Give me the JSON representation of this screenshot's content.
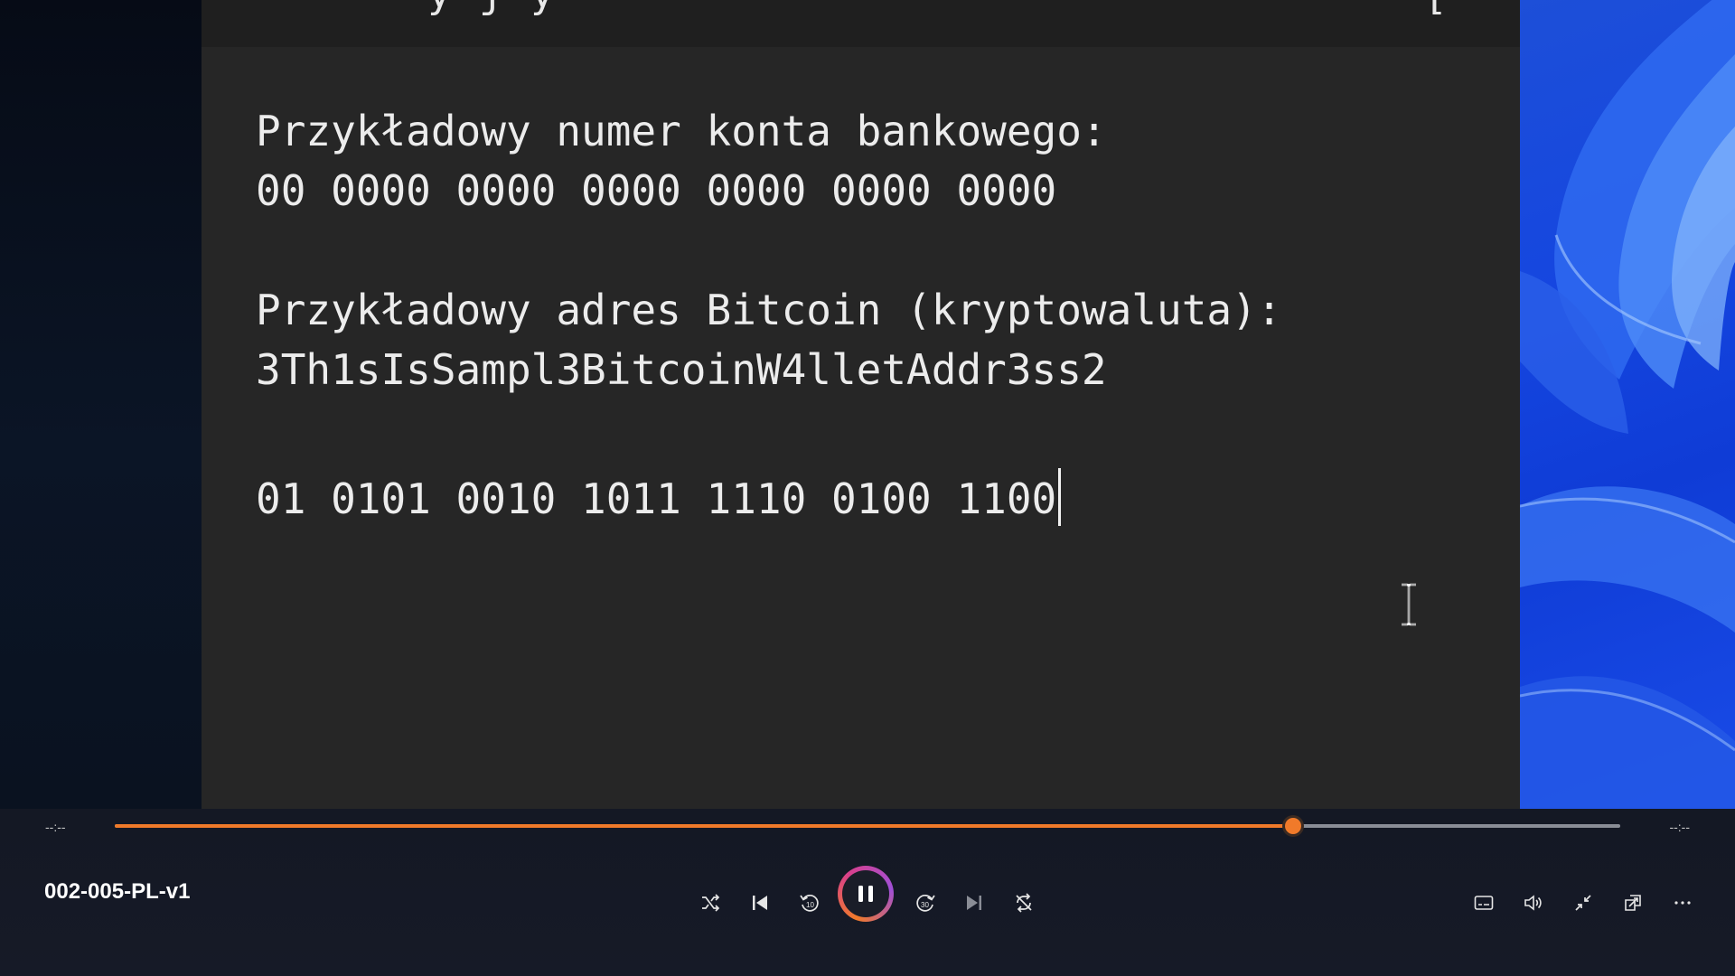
{
  "editor": {
    "title_fragment": "y j   y",
    "title_bracket": "[",
    "lines": [
      "Przykładowy numer konta bankowego:",
      "00 0000 0000 0000 0000 0000 0000",
      "Przykładowy adres Bitcoin (kryptowaluta):",
      "3Th1sIsSampl3BitcoinW4lletAddr3ss2",
      "01 0101 0010 1011 1110 0100 1100"
    ]
  },
  "player": {
    "time_elapsed": "--:--",
    "time_remaining": "--:--",
    "progress_fraction": 0.783,
    "media_title": "002-005-PL-v1",
    "accent_color": "#f07a2a",
    "controls": {
      "shuffle": "shuffle-icon",
      "previous": "previous-icon",
      "skip_back": "skip-back-10-icon",
      "play_pause": "pause-icon",
      "skip_forward": "skip-forward-30-icon",
      "next": "next-icon",
      "repeat": "repeat-off-icon",
      "captions": "captions-icon",
      "volume": "volume-icon",
      "miniplayer": "exit-fullscreen-icon",
      "cast": "cast-icon",
      "more": "more-options-icon",
      "skip_back_label": "10",
      "skip_forward_label": "30"
    }
  }
}
